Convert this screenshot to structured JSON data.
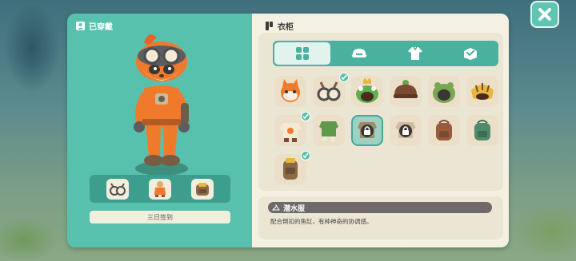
{
  "worn_panel": {
    "title": "已穿戴",
    "slot_icons": [
      "goggles-icon",
      "diving-suit-icon",
      "backpack-icon"
    ],
    "checkin_label": "三日签到"
  },
  "wardrobe": {
    "title": "衣柜",
    "tabs": [
      {
        "name": "grid-tab",
        "icon": "grid-icon",
        "active": true
      },
      {
        "name": "hat-tab",
        "icon": "hat-icon",
        "active": false
      },
      {
        "name": "clothes-tab",
        "icon": "clothes-icon",
        "active": false
      },
      {
        "name": "accessory-tab",
        "icon": "box-icon",
        "active": false
      }
    ],
    "items": [
      {
        "name": "fox-face-item",
        "owned": false,
        "locked": false,
        "selected": false
      },
      {
        "name": "goggles-item",
        "owned": true,
        "locked": false,
        "selected": false
      },
      {
        "name": "frog-crown-hat-item",
        "owned": false,
        "locked": false,
        "selected": false
      },
      {
        "name": "brown-cap-item",
        "owned": false,
        "locked": false,
        "selected": false
      },
      {
        "name": "frog-hood-item",
        "owned": false,
        "locked": false,
        "selected": false
      },
      {
        "name": "tiger-mask-item",
        "owned": false,
        "locked": false,
        "selected": false
      },
      {
        "name": "orange-shirt-item",
        "owned": true,
        "locked": false,
        "selected": false
      },
      {
        "name": "green-outfit-item",
        "owned": false,
        "locked": false,
        "selected": false
      },
      {
        "name": "locked-outfit-item",
        "owned": false,
        "locked": true,
        "selected": true
      },
      {
        "name": "locked-shirt-item",
        "owned": false,
        "locked": true,
        "selected": false
      },
      {
        "name": "brown-backpack-item",
        "owned": false,
        "locked": false,
        "selected": false
      },
      {
        "name": "green-backpack-item",
        "owned": false,
        "locked": false,
        "selected": false
      },
      {
        "name": "tank-backpack-item",
        "owned": true,
        "locked": false,
        "selected": false
      }
    ]
  },
  "detail": {
    "item_name": "潜水服",
    "description": "配合倒扣的鱼缸，有种神奇的协调感。"
  },
  "colors": {
    "teal": "#58c1ad",
    "tab_bar": "#4bb19f",
    "cream": "#f4f0e2",
    "accent_orange": "#f0782a"
  }
}
